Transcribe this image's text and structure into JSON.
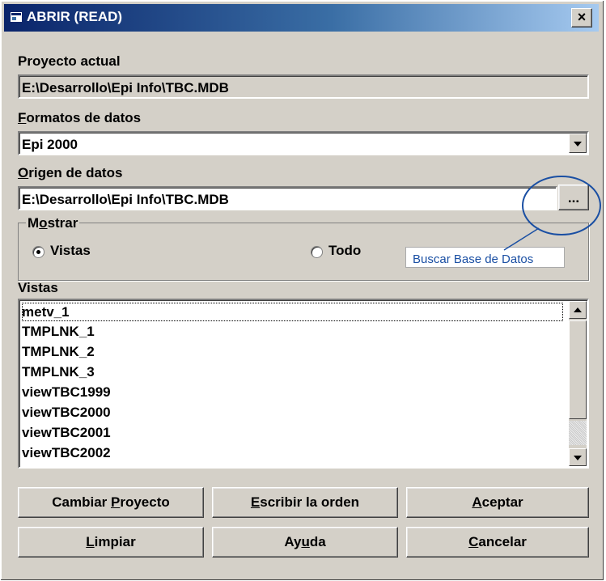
{
  "window": {
    "title": "ABRIR (READ)",
    "close_label": "×"
  },
  "proyecto": {
    "label": "Proyecto actual",
    "value": "E:\\Desarrollo\\Epi Info\\TBC.MDB"
  },
  "formatos": {
    "label": "Formatos de datos",
    "label_key": "F",
    "label_rest": "ormatos de datos",
    "value": "Epi 2000"
  },
  "origen": {
    "label": "Origen de datos",
    "label_key": "O",
    "label_rest": "rigen de datos",
    "value": "E:\\Desarrollo\\Epi Info\\TBC.MDB",
    "browse_label": "..."
  },
  "mostrar": {
    "label": "Mostrar",
    "label_pre": "M",
    "label_key": "o",
    "label_rest": "strar",
    "options": [
      {
        "label": "Vistas",
        "selected": true
      },
      {
        "label": "Todo",
        "selected": false
      }
    ]
  },
  "tooltip": {
    "text": "Buscar Base de Datos"
  },
  "vistas": {
    "label": "Vistas",
    "items": [
      "metv_1",
      "TMPLNK_1",
      "TMPLNK_2",
      "TMPLNK_3",
      "viewTBC1999",
      "viewTBC2000",
      "viewTBC2001",
      "viewTBC2002"
    ]
  },
  "buttons": {
    "cambiar": {
      "pre": "Cambiar ",
      "key": "P",
      "rest": "royecto"
    },
    "escribir": {
      "pre": "",
      "key": "E",
      "rest": "scribir la orden"
    },
    "aceptar": {
      "pre": "",
      "key": "A",
      "rest": "ceptar"
    },
    "limpiar": {
      "pre": "",
      "key": "L",
      "rest": "impiar"
    },
    "ayuda": {
      "pre": "Ay",
      "key": "u",
      "rest": "da"
    },
    "cancelar": {
      "pre": "",
      "key": "C",
      "rest": "ancelar"
    }
  },
  "colors": {
    "titlebar_start": "#0a246a",
    "titlebar_end": "#a6caf0",
    "annotation": "#1a4fa3",
    "face": "#d4d0c8"
  },
  "icons": [
    "window-icon",
    "close-icon",
    "chevron-down-icon",
    "radio-icon",
    "scroll-up-icon",
    "scroll-down-icon"
  ]
}
